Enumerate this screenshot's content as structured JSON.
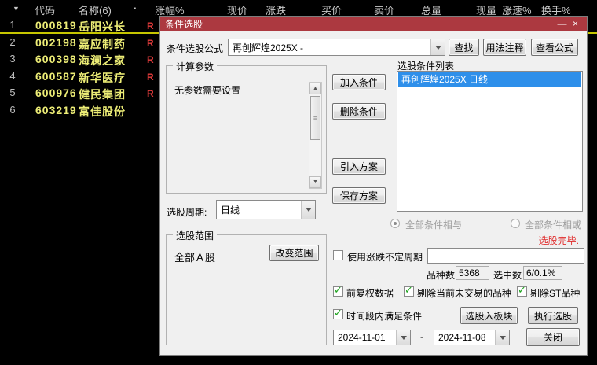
{
  "icons": {
    "sort": "▼",
    "dot": "·",
    "minimize": "—",
    "close": "×",
    "check": "✓",
    "grip": "≡",
    "scroll_up": "▲",
    "scroll_down": "▼"
  },
  "colors": {
    "titlebar_red": "#AC3940",
    "selection_blue": "#2E8FEA",
    "status_red": "#E02D2D",
    "stock_yellow": "#EDED76",
    "check_green": "#1CA31C",
    "row_underline_yellow": "#C6C600"
  },
  "table": {
    "headers": [
      "代码",
      "名称(6)",
      "·",
      "涨幅%",
      "现价",
      "涨跌",
      "买价",
      "卖价",
      "总量",
      "现量",
      "涨速%",
      "换手%"
    ],
    "rows": [
      {
        "idx": "1",
        "code": "000819",
        "name": "岳阳兴长",
        "r": "R"
      },
      {
        "idx": "2",
        "code": "002198",
        "name": "嘉应制药",
        "r": "R"
      },
      {
        "idx": "3",
        "code": "600398",
        "name": "海澜之家",
        "r": "R"
      },
      {
        "idx": "4",
        "code": "600587",
        "name": "新华医疗",
        "r": "R"
      },
      {
        "idx": "5",
        "code": "600976",
        "name": "健民集团",
        "r": "R"
      },
      {
        "idx": "6",
        "code": "603219",
        "name": "富佳股份",
        "r": ""
      }
    ]
  },
  "dialog": {
    "title": "条件选股",
    "formula": {
      "label": "条件选股公式",
      "value": "再创辉煌2025X -",
      "find": "查找",
      "usage": "用法注释",
      "view": "查看公式"
    },
    "params": {
      "label": "计算参数",
      "empty": "无参数需要设置"
    },
    "period": {
      "label": "选股周期:",
      "value": "日线"
    },
    "range": {
      "label": "选股范围",
      "value": "全部Ａ股",
      "change": "改变范围"
    },
    "actions": {
      "add": "加入条件",
      "del": "删除条件",
      "import": "引入方案",
      "save": "保存方案"
    },
    "cond_list": {
      "label": "选股条件列表",
      "selected": "再创辉煌2025X  日线"
    },
    "radio_and": "全部条件相与",
    "radio_or": "全部条件相或",
    "status": "选股完毕.",
    "unfixed": {
      "label": "使用涨跌不定周期",
      "value": ""
    },
    "counts": {
      "total_label": "品种数",
      "total": "5368",
      "sel_label": "选中数",
      "sel": "6/0.1%"
    },
    "opts": {
      "fq": "前复权数据",
      "skip": "剔除当前未交易的品种",
      "st": "剔除ST品种",
      "time": "时间段内满足条件"
    },
    "to_block": "选股入板块",
    "exec": "执行选股",
    "date_from": "2024-11-01",
    "date_sep": "-",
    "date_to": "2024-11-08",
    "close_btn": "关闭"
  }
}
